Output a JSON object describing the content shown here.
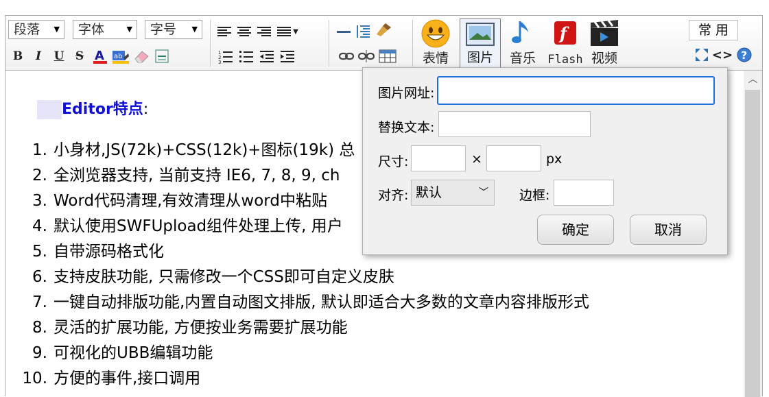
{
  "toolbar": {
    "paragraph": "段落",
    "font": "字体",
    "font_size": "字号",
    "emotion_label": "表情",
    "image_label": "图片",
    "music_label": "音乐",
    "flash_label": "Flash",
    "video_label": "视频",
    "common_label": "常 用"
  },
  "content": {
    "title_text": "Editor特点",
    "title_colon": ":",
    "items": [
      {
        "num": "1.",
        "text": "小身材,JS(72k)+CSS(12k)+图标(19k) 总"
      },
      {
        "num": "2.",
        "text": "全浏览器支持, 当前支持 IE6, 7, 8, 9, ch"
      },
      {
        "num": "3.",
        "text": "Word代码清理,有效清理从word中粘贴"
      },
      {
        "num": "4.",
        "text": "默认使用SWFUpload组件处理上传, 用户"
      },
      {
        "num": "5.",
        "text": "自带源码格式化"
      },
      {
        "num": "6.",
        "text": "支持皮肤功能, 只需修改一个CSS即可自定义皮肤"
      },
      {
        "num": "7.",
        "text": "一键自动排版功能,内置自动图文排版, 默认即适合大多数的文章内容排版形式"
      },
      {
        "num": "8.",
        "text": "灵活的扩展功能, 方便按业务需要扩展功能"
      },
      {
        "num": "9.",
        "text": "可视化的UBB编辑功能"
      },
      {
        "num": "10.",
        "text": "方便的事件,接口调用"
      }
    ]
  },
  "dialog": {
    "url_label": "图片网址:",
    "url_value": "",
    "alt_label": "替换文本:",
    "alt_value": "",
    "size_label": "尺寸:",
    "times": "×",
    "unit": "px",
    "align_label": "对齐:",
    "align_value": "默认",
    "border_label": "边框:",
    "ok": "确定",
    "cancel": "取消"
  },
  "colors": {
    "title": "#1010d8",
    "focus_border": "#1e6fd8"
  }
}
